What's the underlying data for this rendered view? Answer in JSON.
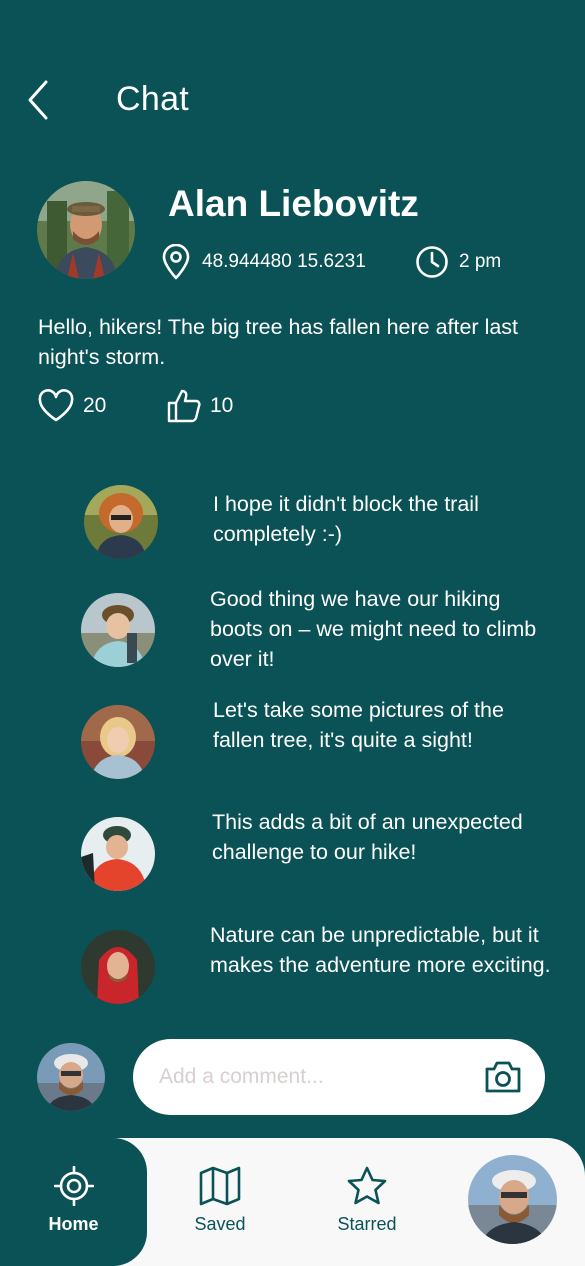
{
  "header": {
    "title": "Chat"
  },
  "post": {
    "author": "Alan Liebovitz",
    "coordinates": "48.944480 15.6231",
    "time": "2 pm",
    "text": "Hello, hikers! The big tree has fallen here after last night's storm.",
    "likes": "20",
    "thumbs_up": "10"
  },
  "comments": [
    {
      "text": "I hope it didn't block the trail completely :-)"
    },
    {
      "text": "Good thing we have our hiking boots on – we might need to climb over it!"
    },
    {
      "text": "Let's take some pictures of the fallen tree, it's quite a sight!"
    },
    {
      "text": "This adds a bit of an unexpected challenge to our hike!"
    },
    {
      "text": "Nature can be unpredictable, but it makes the adventure more exciting."
    }
  ],
  "composer": {
    "placeholder": "Add a comment..."
  },
  "nav": {
    "home": "Home",
    "saved": "Saved",
    "starred": "Starred"
  },
  "colors": {
    "primary": "#0a5256",
    "nav_background": "#f8f8f8",
    "text_light": "#ffffff"
  }
}
